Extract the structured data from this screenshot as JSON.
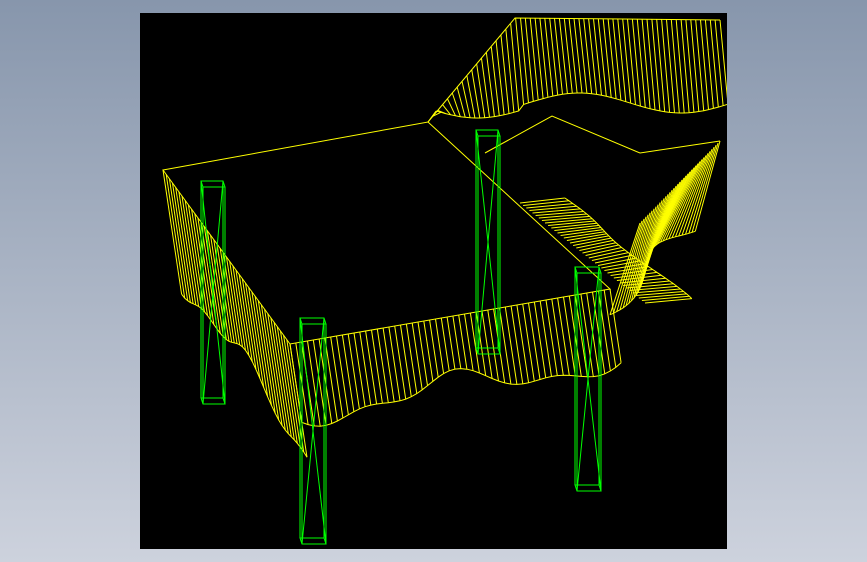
{
  "colors": {
    "background_top": "#8796AC",
    "background_bottom": "#CDD2DD",
    "viewport_background": "#000000",
    "tablecloth_wireframe": "#FFFF00",
    "table_legs_wireframe": "#00FF00"
  },
  "scene": {
    "render_mode": "wireframe",
    "objects": [
      {
        "name": "tablecloth",
        "color_key": "tablecloth_wireframe"
      },
      {
        "name": "table-leg-front-left",
        "color_key": "table_legs_wireframe"
      },
      {
        "name": "table-leg-front-center",
        "color_key": "table_legs_wireframe"
      },
      {
        "name": "table-leg-back",
        "color_key": "table_legs_wireframe"
      },
      {
        "name": "table-leg-right",
        "color_key": "table_legs_wireframe"
      }
    ]
  }
}
